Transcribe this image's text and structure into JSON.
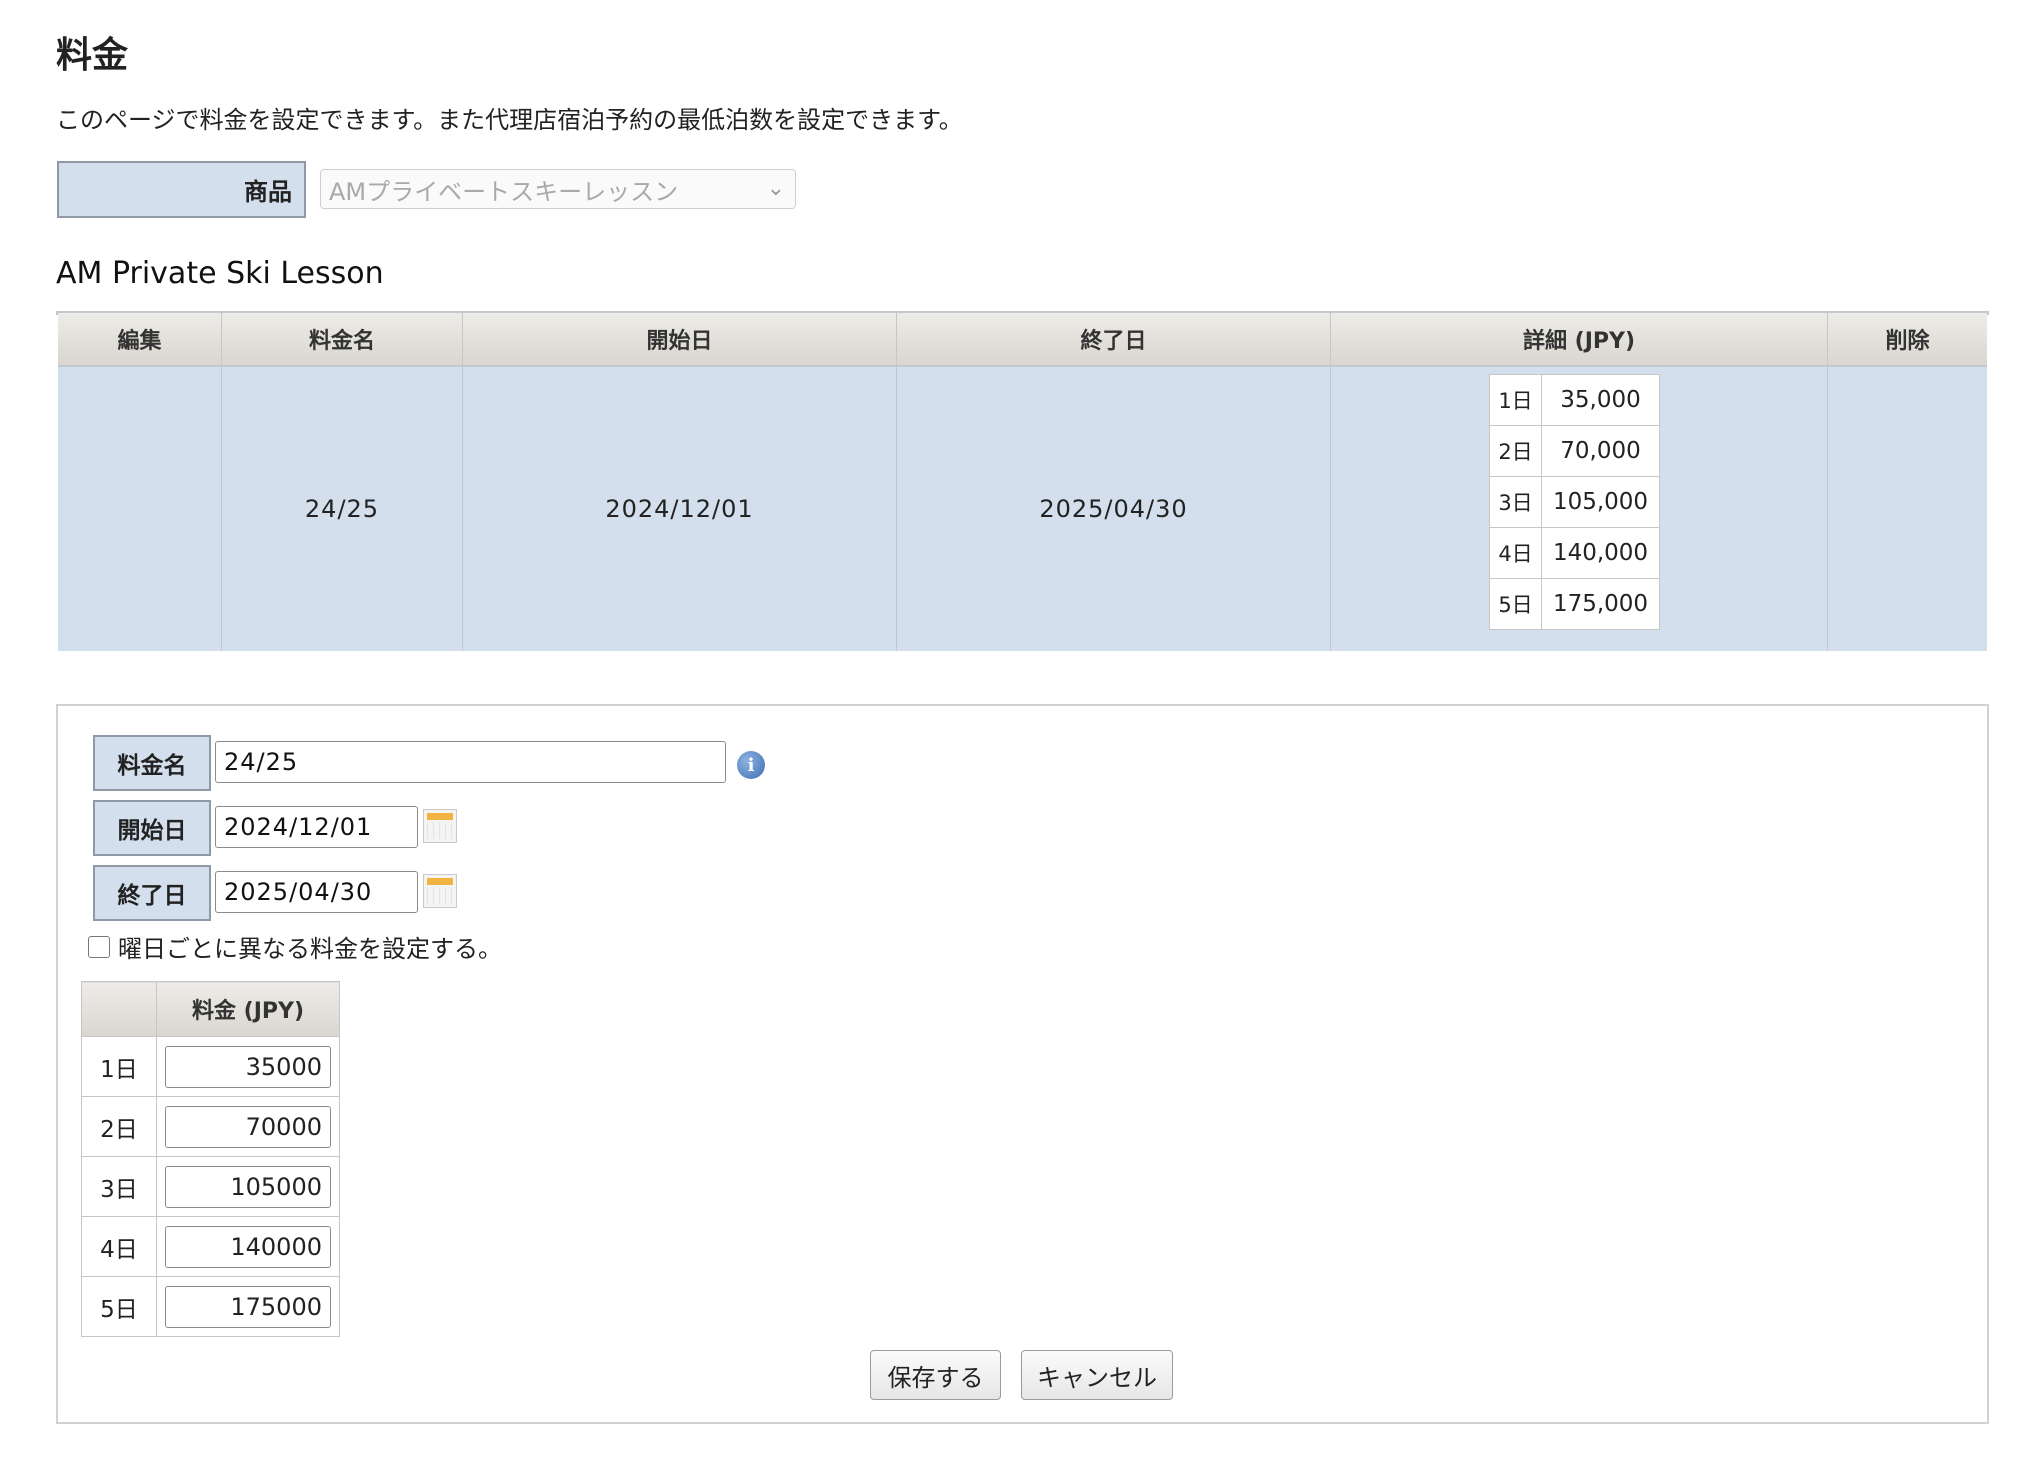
{
  "page": {
    "title": "料金",
    "description": "このページで料金を設定できます。また代理店宿泊予約の最低泊数を設定できます。"
  },
  "product": {
    "label": "商品",
    "selected": "AMプライベートスキーレッスン"
  },
  "section_title": "AM Private Ski Lesson",
  "table": {
    "headers": {
      "edit": "編集",
      "rate_name": "料金名",
      "start": "開始日",
      "end": "終了日",
      "details": "詳細 (JPY)",
      "delete": "削除"
    },
    "rows": [
      {
        "rate_name": "24/25",
        "start": "2024/12/01",
        "end": "2025/04/30",
        "details": [
          {
            "day": "1日",
            "amount": "35,000"
          },
          {
            "day": "2日",
            "amount": "70,000"
          },
          {
            "day": "3日",
            "amount": "105,000"
          },
          {
            "day": "4日",
            "amount": "140,000"
          },
          {
            "day": "5日",
            "amount": "175,000"
          }
        ]
      }
    ]
  },
  "form": {
    "rate_name_label": "料金名",
    "rate_name_value": "24/25",
    "start_label": "開始日",
    "start_value": "2024/12/01",
    "end_label": "終了日",
    "end_value": "2025/04/30",
    "weekday_checkbox_label": "曜日ごとに異なる料金を設定する。",
    "weekday_checked": false,
    "price_header": "料金 (JPY)",
    "prices": [
      {
        "day": "1日",
        "value": "35000"
      },
      {
        "day": "2日",
        "value": "70000"
      },
      {
        "day": "3日",
        "value": "105000"
      },
      {
        "day": "4日",
        "value": "140000"
      },
      {
        "day": "5日",
        "value": "175000"
      }
    ],
    "save_label": "保存する",
    "cancel_label": "キャンセル"
  },
  "icons": {
    "info": "info-icon",
    "calendar": "calendar-icon",
    "dropdown": "chevron-down-icon"
  }
}
